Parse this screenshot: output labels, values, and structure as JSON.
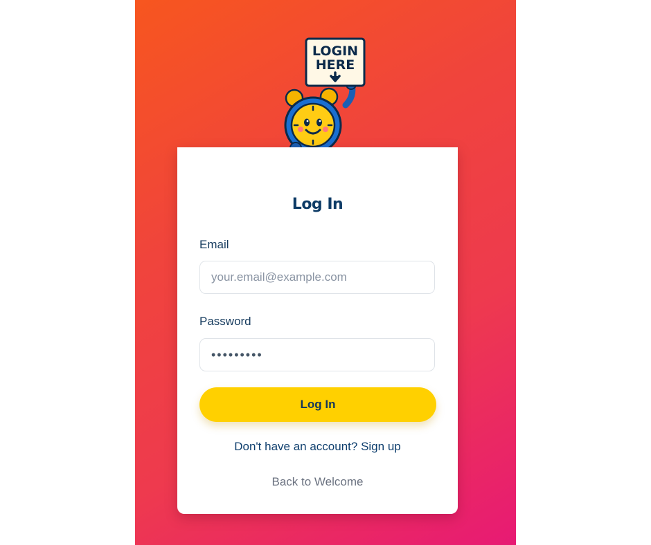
{
  "mascot": {
    "sign_line1": "LOGIN",
    "sign_line2": "HERE"
  },
  "form": {
    "title": "Log In",
    "email_label": "Email",
    "email_placeholder": "your.email@example.com",
    "email_value": "",
    "password_label": "Password",
    "password_value": "•••••••••",
    "submit_label": "Log In",
    "signup_link": "Don't have an account? Sign up",
    "back_link": "Back to Welcome"
  },
  "colors": {
    "gradient_start": "#f7561f",
    "gradient_end": "#e71a74",
    "button": "#ffd000",
    "heading": "#0d3b66"
  }
}
